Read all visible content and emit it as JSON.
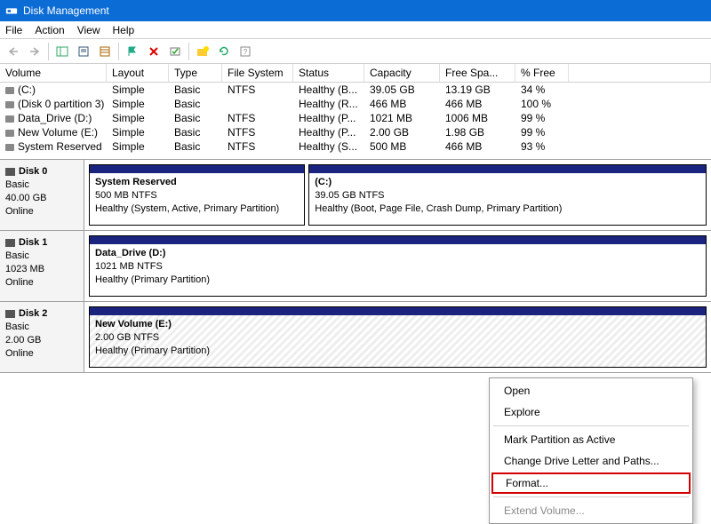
{
  "window": {
    "title": "Disk Management"
  },
  "menu": {
    "file": "File",
    "action": "Action",
    "view": "View",
    "help": "Help"
  },
  "columns": {
    "volume": "Volume",
    "layout": "Layout",
    "type": "Type",
    "filesystem": "File System",
    "status": "Status",
    "capacity": "Capacity",
    "freespace": "Free Spa...",
    "pctfree": "% Free"
  },
  "volumes": [
    {
      "name": "(C:)",
      "layout": "Simple",
      "type": "Basic",
      "fs": "NTFS",
      "status": "Healthy (B...",
      "cap": "39.05 GB",
      "free": "13.19 GB",
      "pct": "34 %"
    },
    {
      "name": "(Disk 0 partition 3)",
      "layout": "Simple",
      "type": "Basic",
      "fs": "",
      "status": "Healthy (R...",
      "cap": "466 MB",
      "free": "466 MB",
      "pct": "100 %"
    },
    {
      "name": "Data_Drive (D:)",
      "layout": "Simple",
      "type": "Basic",
      "fs": "NTFS",
      "status": "Healthy (P...",
      "cap": "1021 MB",
      "free": "1006 MB",
      "pct": "99 %"
    },
    {
      "name": "New Volume (E:)",
      "layout": "Simple",
      "type": "Basic",
      "fs": "NTFS",
      "status": "Healthy (P...",
      "cap": "2.00 GB",
      "free": "1.98 GB",
      "pct": "99 %"
    },
    {
      "name": "System Reserved",
      "layout": "Simple",
      "type": "Basic",
      "fs": "NTFS",
      "status": "Healthy (S...",
      "cap": "500 MB",
      "free": "466 MB",
      "pct": "93 %"
    }
  ],
  "disks": [
    {
      "title": "Disk 0",
      "type": "Basic",
      "size": "40.00 GB",
      "state": "Online",
      "parts": [
        {
          "name": "System Reserved",
          "info": "500 MB NTFS",
          "status": "Healthy (System, Active, Primary Partition)",
          "hatched": false
        },
        {
          "name": "(C:)",
          "info": "39.05 GB NTFS",
          "status": "Healthy (Boot, Page File, Crash Dump, Primary Partition)",
          "hatched": false
        }
      ]
    },
    {
      "title": "Disk 1",
      "type": "Basic",
      "size": "1023 MB",
      "state": "Online",
      "parts": [
        {
          "name": "Data_Drive  (D:)",
          "info": "1021 MB NTFS",
          "status": "Healthy (Primary Partition)",
          "hatched": false
        }
      ]
    },
    {
      "title": "Disk 2",
      "type": "Basic",
      "size": "2.00 GB",
      "state": "Online",
      "parts": [
        {
          "name": "New Volume  (E:)",
          "info": "2.00 GB NTFS",
          "status": "Healthy (Primary Partition)",
          "hatched": true
        }
      ]
    }
  ],
  "context": {
    "open": "Open",
    "explore": "Explore",
    "mark_active": "Mark Partition as Active",
    "change_letter": "Change Drive Letter and Paths...",
    "format": "Format...",
    "extend": "Extend Volume..."
  }
}
